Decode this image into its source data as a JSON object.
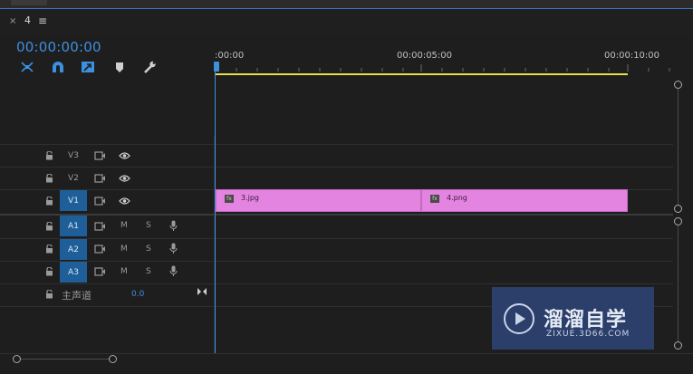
{
  "panel": {
    "tab_close": "×",
    "tab_name": "4",
    "tab_menu": "≡",
    "timecode": "00:00:00:00"
  },
  "toolbar": {
    "tools": [
      "nest-sequence-icon",
      "snap-icon",
      "linked-selection-icon",
      "add-marker-icon",
      "timeline-settings-icon"
    ]
  },
  "ruler": {
    "labels": [
      ":00:00",
      "00:00:05:00",
      "00:00:10:00"
    ]
  },
  "tracks": {
    "video": [
      {
        "name": "V3",
        "active": false
      },
      {
        "name": "V2",
        "active": false
      },
      {
        "name": "V1",
        "active": true
      }
    ],
    "audio": [
      {
        "name": "A1",
        "m": "M",
        "s": "S"
      },
      {
        "name": "A2",
        "m": "M",
        "s": "S"
      },
      {
        "name": "A3",
        "m": "M",
        "s": "S"
      }
    ],
    "master": {
      "label": "主声道",
      "value": "0.0"
    }
  },
  "clips": [
    {
      "name": "3.jpg",
      "fx": "fx"
    },
    {
      "name": "4.png",
      "fx": "fx"
    }
  ],
  "watermark": {
    "main": "溜溜自学",
    "sub": "ZIXUE.3D66.COM"
  },
  "colors": {
    "accent": "#3d8fe0",
    "clip": "#e384e0",
    "work_area": "#e8e04a",
    "track_active": "#1f5f99"
  }
}
